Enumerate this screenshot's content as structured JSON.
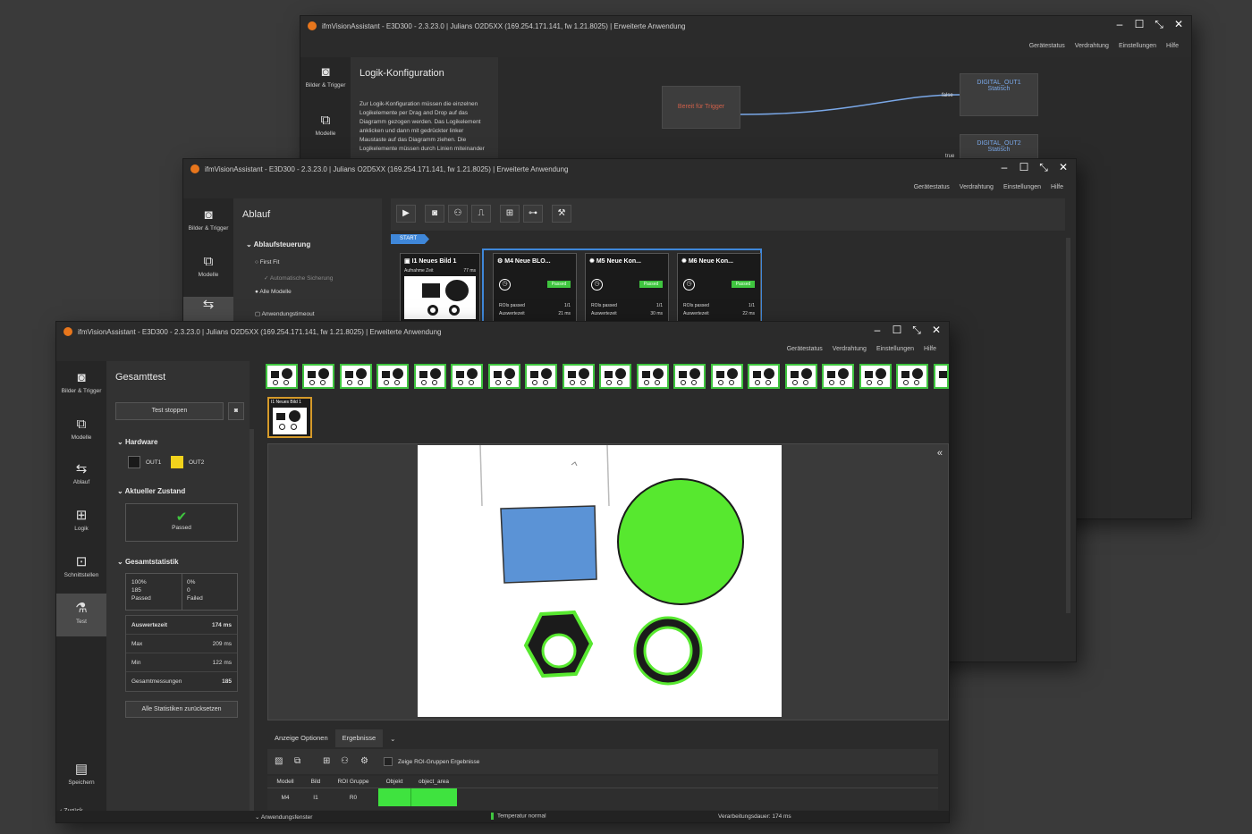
{
  "windows": {
    "back": {
      "title": "ifmVisionAssistant - E3D300 - 2.3.23.0 | Julians O2D5XX (169.254.171.141, fw 1.21.8025) | Erweiterte Anwendung",
      "menu": [
        "Gerätestatus",
        "Verdrahtung",
        "Einstellungen",
        "Hilfe"
      ],
      "nav": [
        {
          "label": "Bilder & Trigger",
          "icon": "camera-icon"
        },
        {
          "label": "Modelle",
          "icon": "model-icon"
        }
      ],
      "panel_title": "Logik-Konfiguration",
      "panel_text": "Zur Logik-Konfiguration müssen die einzelnen Logikelemente per Drag and Drop auf das Diagramm gezogen werden. Das Logikelement anklicken und dann mit gedrückter linker Maustaste auf das Diagramm ziehen. Die Logikelemente müssen durch Linien miteinander",
      "node_trigger": "Bereit für Trigger",
      "node_out1": "DIGITAL_OUT1",
      "node_out1_sub": "Statisch",
      "node_out2": "DIGITAL_OUT2",
      "node_out2_sub": "Statisch",
      "wire_false": "false",
      "wire_true": "true"
    },
    "middle": {
      "title": "ifmVisionAssistant - E3D300 - 2.3.23.0 | Julians O2D5XX (169.254.171.141, fw 1.21.8025) | Erweiterte Anwendung",
      "menu": [
        "Gerätestatus",
        "Verdrahtung",
        "Einstellungen",
        "Hilfe"
      ],
      "nav": [
        {
          "label": "Bilder & Trigger",
          "icon": "camera-icon"
        },
        {
          "label": "Modelle",
          "icon": "model-icon"
        }
      ],
      "panel_title": "Ablauf",
      "section": "Ablaufsteuerung",
      "options": [
        "First Fit",
        "Automatische Sicherung",
        "Alle Modelle",
        "Anwendungstimeout"
      ],
      "start_label": "START",
      "image_card": {
        "title": "I1 Neues Bild 1",
        "sub": "Aufnahme Zeit",
        "time": "77 ms"
      },
      "model_cards": [
        {
          "title": "M4 Neue BLO...",
          "status": "Passed",
          "rows": [
            [
              "ROIs passed",
              "1/1"
            ],
            [
              "Auswertezeit",
              "21 ms"
            ]
          ]
        },
        {
          "title": "M5 Neue Kon...",
          "status": "Passed",
          "rows": [
            [
              "ROIs passed",
              "1/1"
            ],
            [
              "Auswertezeit",
              "30 ms"
            ]
          ]
        },
        {
          "title": "M6 Neue Kon...",
          "status": "Passed",
          "rows": [
            [
              "ROIs passed",
              "1/1"
            ],
            [
              "Auswertezeit",
              "22 ms"
            ]
          ]
        }
      ]
    },
    "front": {
      "title": "ifmVisionAssistant - E3D300 - 2.3.23.0 | Julians O2D5XX (169.254.171.141, fw 1.21.8025) | Erweiterte Anwendung",
      "menu": [
        "Gerätestatus",
        "Verdrahtung",
        "Einstellungen",
        "Hilfe"
      ],
      "nav": [
        {
          "label": "Bilder & Trigger",
          "icon": "camera-icon"
        },
        {
          "label": "Modelle",
          "icon": "model-icon"
        },
        {
          "label": "Ablauf",
          "icon": "flow-icon"
        },
        {
          "label": "Logik",
          "icon": "logic-icon"
        },
        {
          "label": "Schnittstellen",
          "icon": "interface-icon"
        },
        {
          "label": "Test",
          "icon": "flask-icon"
        },
        {
          "label": "Speichern",
          "icon": "save-icon"
        }
      ],
      "panel_title": "Gesamttest",
      "stop_button": "Test stoppen",
      "hardware_section": "Hardware",
      "out1": "OUT1",
      "out2": "OUT2",
      "state_section": "Aktueller Zustand",
      "state_value": "Passed",
      "stats_section": "Gesamtstatistik",
      "stats_pass": {
        "percent": "100%",
        "count": "185",
        "label": "Passed"
      },
      "stats_fail": {
        "percent": "0%",
        "count": "0",
        "label": "Failed"
      },
      "stats_rows": [
        {
          "label": "Auswertezeit",
          "value": "174 ms"
        },
        {
          "label": "Max",
          "value": "209 ms"
        },
        {
          "label": "Min",
          "value": "122 ms"
        },
        {
          "label": "Gesamtmessungen",
          "value": "185"
        }
      ],
      "reset_button": "Alle Statistiken zurücksetzen",
      "thumb_label": "I1 Neues Bild 1",
      "tabs": [
        "Anzeige Optionen",
        "Ergebnisse"
      ],
      "roi_checkbox": "Zeige ROI-Gruppen Ergebnisse",
      "table_headers": [
        "Modell",
        "Bild",
        "ROI Gruppe",
        "Objekt",
        "object_area"
      ],
      "table_row": [
        "M4",
        "I1",
        "R0",
        "",
        ""
      ],
      "back_label": "Zurück",
      "status_left": "Anwendungsfenster",
      "status_temp": "Temperatur normal",
      "status_time": "Verarbeitungsdauer: 174 ms"
    }
  },
  "colors": {
    "accent_green": "#3fc53f",
    "out2_yellow": "#f2d31c",
    "blob_blue": "#5b93d6",
    "app_orange": "#e8761c"
  }
}
